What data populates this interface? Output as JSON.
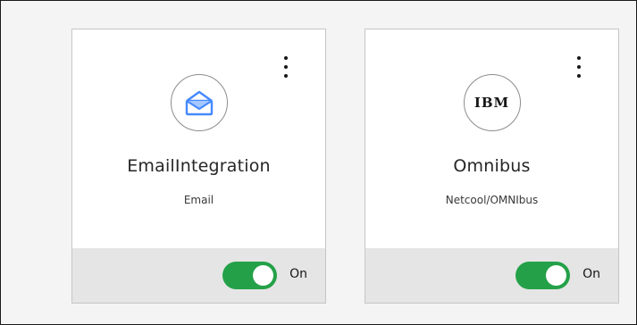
{
  "cards": [
    {
      "title": "EmailIntegration",
      "subtitle": "Email",
      "icon": "envelope-icon",
      "toggle_label": "On",
      "toggle_on": true
    },
    {
      "title": "Omnibus",
      "subtitle": "Netcool/OMNIbus",
      "icon": "ibm-logo-icon",
      "logo_text": "IBM",
      "toggle_label": "On",
      "toggle_on": true
    }
  ],
  "colors": {
    "toggle_on": "#24a148",
    "envelope_blue": "#4589ff",
    "footer_bg": "#e5e5e5"
  }
}
